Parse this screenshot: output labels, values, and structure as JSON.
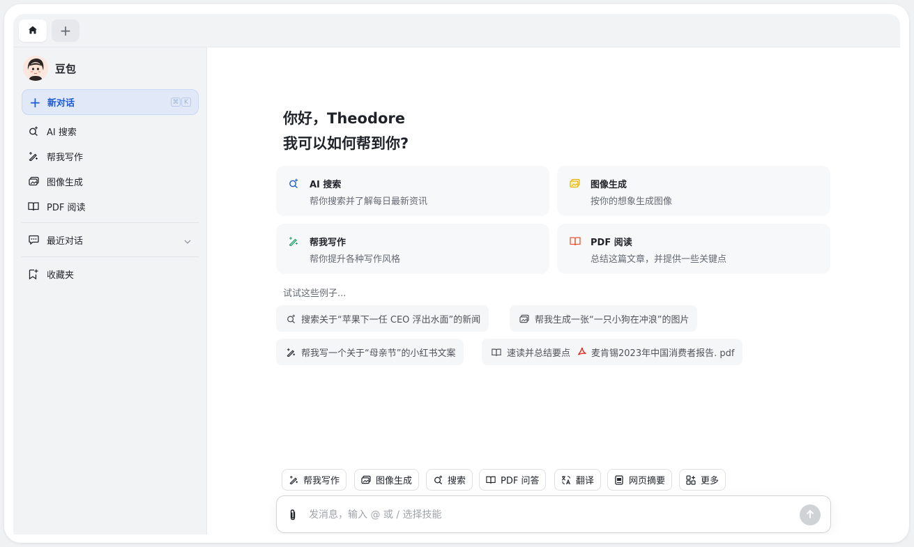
{
  "tabs": {
    "home_icon": "home-icon",
    "new_tab_label": "+"
  },
  "sidebar": {
    "brand_name": "豆包",
    "new_chat": {
      "label": "新对话",
      "shortcut": [
        "⌘",
        "K"
      ]
    },
    "items": [
      {
        "label": "AI 搜索",
        "icon": "search-sparkle-icon"
      },
      {
        "label": "帮我写作",
        "icon": "pen-sparkle-icon"
      },
      {
        "label": "图像生成",
        "icon": "image-icon"
      },
      {
        "label": "PDF 阅读",
        "icon": "book-icon"
      }
    ],
    "recent": {
      "label": "最近对话",
      "icon": "chat-icon"
    },
    "favorites": {
      "label": "收藏夹",
      "icon": "bookmark-icon"
    }
  },
  "main": {
    "greeting_line1": "你好，Theodore",
    "greeting_line2": "我可以如何帮到你?",
    "cards": [
      {
        "title": "AI 搜索",
        "desc": "帮你搜索并了解每日最新资讯",
        "icon": "search-sparkle-icon",
        "color": "#1a5ad6"
      },
      {
        "title": "图像生成",
        "desc": "按你的想象生成图像",
        "icon": "image-icon",
        "color": "#e6b000"
      },
      {
        "title": "帮我写作",
        "desc": "帮你提升各种写作风格",
        "icon": "pen-sparkle-icon",
        "color": "#22a06b"
      },
      {
        "title": "PDF 阅读",
        "desc": "总结这篇文章，并提供一些关键点",
        "icon": "book-icon",
        "color": "#e8542f"
      }
    ],
    "try_label": "试试这些例子...",
    "examples": [
      {
        "text": "搜索关于“苹果下一任 CEO 浮出水面”的新闻",
        "icon": "search-sparkle-icon"
      },
      {
        "text": "帮我生成一张“一只小狗在冲浪”的图片",
        "icon": "image-icon"
      },
      {
        "text": "帮我写一个关于“母亲节”的小红书文案",
        "icon": "pen-sparkle-icon"
      },
      {
        "text": "速读并总结要点",
        "icon": "book-icon",
        "file": "麦肯锡2023年中国消费者报告. pdf",
        "file_icon": "pdf-icon"
      }
    ]
  },
  "toolbar": {
    "tools": [
      {
        "label": "帮我写作",
        "icon": "pen-sparkle-icon"
      },
      {
        "label": "图像生成",
        "icon": "image-icon"
      },
      {
        "label": "搜索",
        "icon": "search-sparkle-icon"
      },
      {
        "label": "PDF 问答",
        "icon": "book-icon"
      },
      {
        "label": "翻译",
        "icon": "translate-icon"
      },
      {
        "label": "网页摘要",
        "icon": "webpage-icon"
      },
      {
        "label": "更多",
        "icon": "grid-icon"
      }
    ]
  },
  "composer": {
    "placeholder": "发消息，输入 @ 或 / 选择技能"
  }
}
